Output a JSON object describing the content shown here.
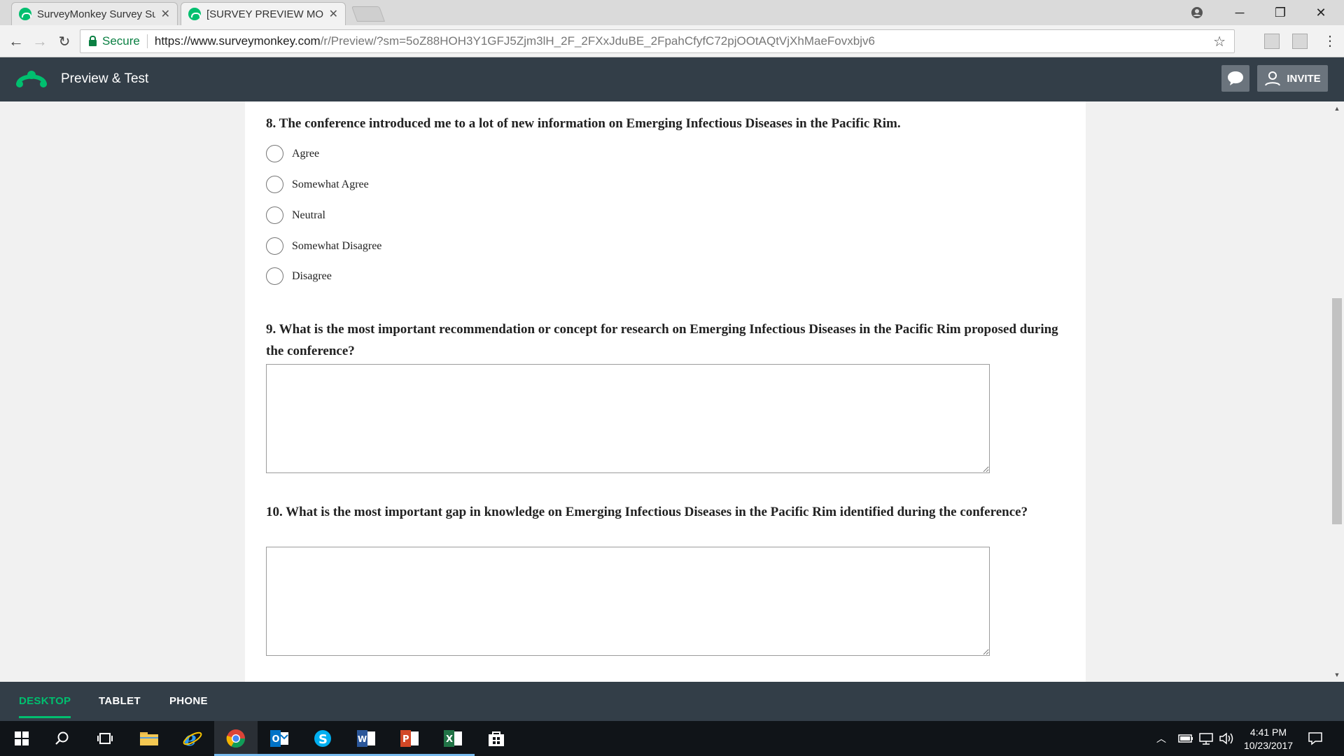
{
  "browser": {
    "tabs": [
      {
        "title": "SurveyMonkey Survey Su",
        "active": false
      },
      {
        "title": "[SURVEY PREVIEW MODE",
        "active": true
      }
    ],
    "address": {
      "secure_label": "Secure",
      "url_host": "https://www.surveymonkey.com",
      "url_path": "/r/Preview/?sm=5oZ88HOH3Y1GFJ5Zjm3lH_2F_2FXxJduBE_2FpahCfyfC72pjOOtAQtVjXhMaeFovxbjv6"
    }
  },
  "header": {
    "title": "Preview & Test",
    "invite_label": "INVITE",
    "accent_color": "#00bf6f",
    "bar_color": "#333e48"
  },
  "survey": {
    "q8": {
      "text": "8. The conference introduced me to a lot of new information on Emerging Infectious Diseases in the Pacific Rim.",
      "choices": [
        "Agree",
        "Somewhat Agree",
        "Neutral",
        "Somewhat Disagree",
        "Disagree"
      ]
    },
    "q9": {
      "text": "9. What is the most important recommendation or concept for research on Emerging Infectious Diseases in the Pacific Rim proposed during the conference?",
      "value": ""
    },
    "q10": {
      "text": "10. What is the most important gap in knowledge on Emerging Infectious Diseases in the Pacific Rim identified during the conference?",
      "value": ""
    }
  },
  "device_tabs": [
    {
      "label": "DESKTOP",
      "active": true
    },
    {
      "label": "TABLET",
      "active": false
    },
    {
      "label": "PHONE",
      "active": false
    }
  ],
  "taskbar": {
    "time": "4:41 PM",
    "date": "10/23/2017",
    "apps": [
      "windows-start-icon",
      "search-icon",
      "task-view-icon",
      "file-explorer-icon",
      "internet-explorer-icon",
      "chrome-icon",
      "outlook-icon",
      "skype-icon",
      "word-icon",
      "powerpoint-icon",
      "excel-icon",
      "store-icon"
    ]
  }
}
